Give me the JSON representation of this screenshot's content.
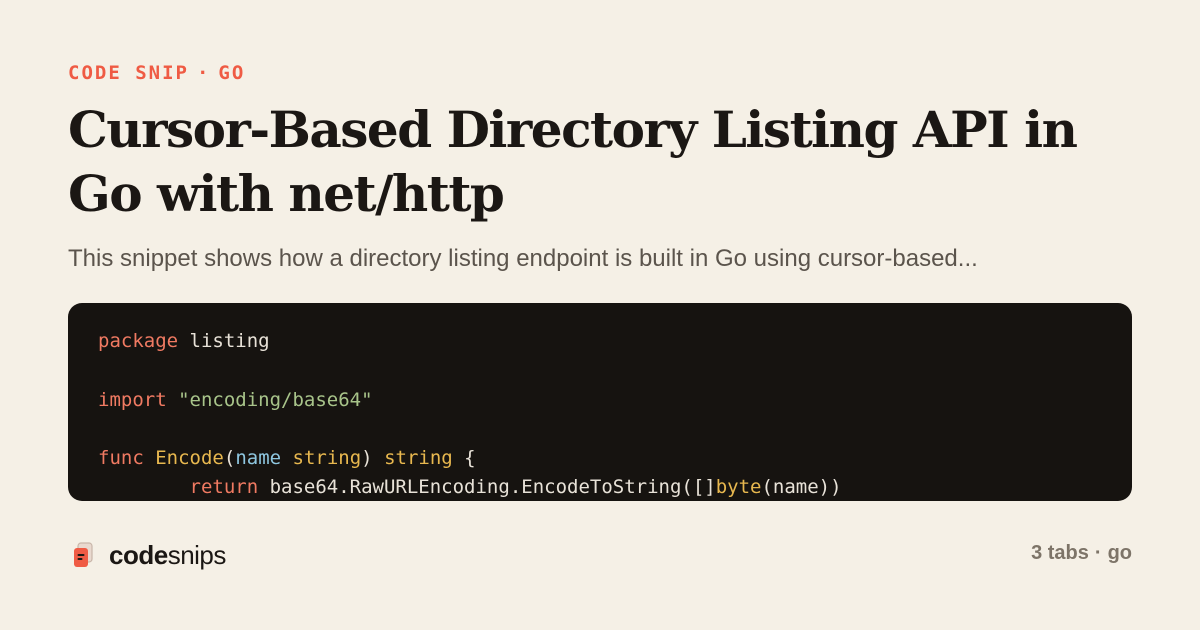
{
  "eyebrow": {
    "category": "CODE SNIP",
    "separator": "·",
    "language": "GO"
  },
  "title": "Cursor-Based Directory Listing API in Go with net/http",
  "description": "This snippet shows how a directory listing endpoint is built in Go using cursor-based...",
  "code": {
    "lines": [
      {
        "tokens": [
          {
            "t": "kw",
            "v": "package"
          },
          {
            "t": "plain",
            "v": " listing"
          }
        ]
      },
      {
        "tokens": []
      },
      {
        "tokens": [
          {
            "t": "kw",
            "v": "import"
          },
          {
            "t": "plain",
            "v": " "
          },
          {
            "t": "str",
            "v": "\"encoding/base64\""
          }
        ]
      },
      {
        "tokens": []
      },
      {
        "tokens": [
          {
            "t": "kw",
            "v": "func"
          },
          {
            "t": "plain",
            "v": " "
          },
          {
            "t": "fn",
            "v": "Encode"
          },
          {
            "t": "plain",
            "v": "("
          },
          {
            "t": "param",
            "v": "name"
          },
          {
            "t": "plain",
            "v": " "
          },
          {
            "t": "typ",
            "v": "string"
          },
          {
            "t": "plain",
            "v": ") "
          },
          {
            "t": "typ",
            "v": "string"
          },
          {
            "t": "plain",
            "v": " {"
          }
        ]
      },
      {
        "tokens": [
          {
            "t": "plain",
            "v": "        "
          },
          {
            "t": "kw",
            "v": "return"
          },
          {
            "t": "plain",
            "v": " base64.RawURLEncoding.EncodeToString([]"
          },
          {
            "t": "typ",
            "v": "byte"
          },
          {
            "t": "plain",
            "v": "(name))"
          }
        ]
      }
    ]
  },
  "brand": {
    "name_bold": "code",
    "name_light": "snips",
    "icon": "snippet-stack-icon",
    "accent_color": "#ef5b44"
  },
  "meta": {
    "tabs": "3 tabs",
    "separator": "·",
    "language": "go"
  },
  "colors": {
    "background": "#f5f0e6",
    "accent": "#ef5b44",
    "code_background": "#161310"
  }
}
